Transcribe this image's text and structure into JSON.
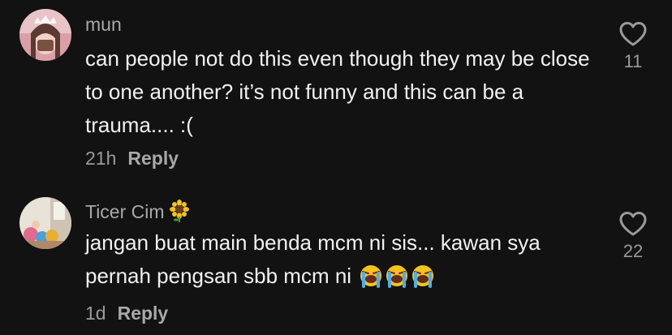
{
  "comments": [
    {
      "username": "mun",
      "text": "can people not do this even though they may be close to one another? it’s not funny and this can be a trauma.... :(",
      "time": "21h",
      "reply_label": "Reply",
      "likes": "11",
      "avatar": "user-photo-girl",
      "heart_icon": "heart-outline-icon"
    },
    {
      "username": "Ticer Cim",
      "username_emoji": "sunflower",
      "text": "jangan buat main benda mcm ni sis... kawan sya pernah pengsan sbb mcm ni",
      "text_emojis": [
        "loudly-crying-face",
        "loudly-crying-face",
        "loudly-crying-face"
      ],
      "time": "1d",
      "reply_label": "Reply",
      "likes": "22",
      "avatar": "user-photo-group",
      "heart_icon": "heart-outline-icon"
    }
  ],
  "colors": {
    "background": "#121212",
    "username": "#a8a8a8",
    "text": "#f1f1f1",
    "meta": "#9a9a9a"
  }
}
